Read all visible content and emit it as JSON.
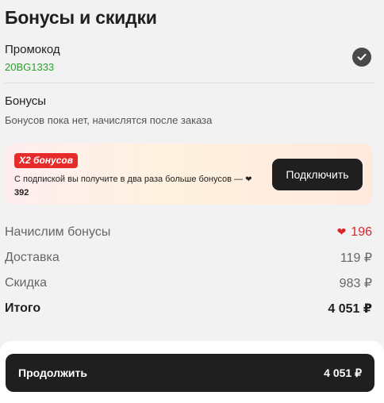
{
  "title": "Бонусы и скидки",
  "promo": {
    "label": "Промокод",
    "code": "20BG1333",
    "check_icon": "check-circle-icon"
  },
  "bonuses": {
    "label": "Бонусы",
    "note": "Бонусов пока нет, начислятся после заказа"
  },
  "promo_card": {
    "badge": "X2 бонусов",
    "text": "С подпиской вы получите в два раза больше бонусов —",
    "amount": "392",
    "button": "Подключить"
  },
  "summary": {
    "rows": [
      {
        "label": "Начислим бонусы",
        "value": "196"
      },
      {
        "label": "Доставка",
        "value": "119 ₽"
      },
      {
        "label": "Скидка",
        "value": "983 ₽"
      },
      {
        "label": "Итого",
        "value": "4 051 ₽"
      }
    ]
  },
  "footer": {
    "button_label": "Продолжить",
    "button_amount": "4 051 ₽"
  },
  "colors": {
    "accent_green": "#2c9f2c",
    "accent_red": "#d8262c",
    "button_dark": "#1f1f1f"
  }
}
